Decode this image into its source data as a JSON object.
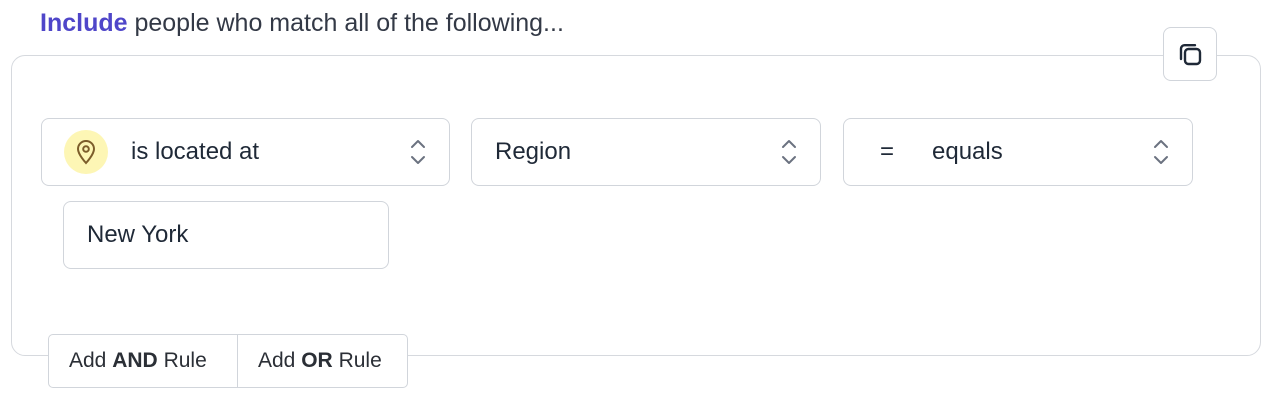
{
  "heading": {
    "mode": "Include",
    "text": "people who match all of the following..."
  },
  "rule": {
    "condition": {
      "label": "is located at",
      "icon": "map-pin-icon"
    },
    "field": {
      "label": "Region"
    },
    "operator": {
      "symbol": "=",
      "label": "equals"
    },
    "value": "New York"
  },
  "actions": {
    "add_and": {
      "prefix": "Add",
      "keyword": "AND",
      "suffix": "Rule"
    },
    "add_or": {
      "prefix": "Add",
      "keyword": "OR",
      "suffix": "Rule"
    },
    "copy_icon": "copy-icon"
  },
  "colors": {
    "accent": "#4f46c9",
    "pin_badge_bg": "#fdf6b5",
    "pin_stroke": "#7c5d2a",
    "border": "#d1d5db"
  }
}
